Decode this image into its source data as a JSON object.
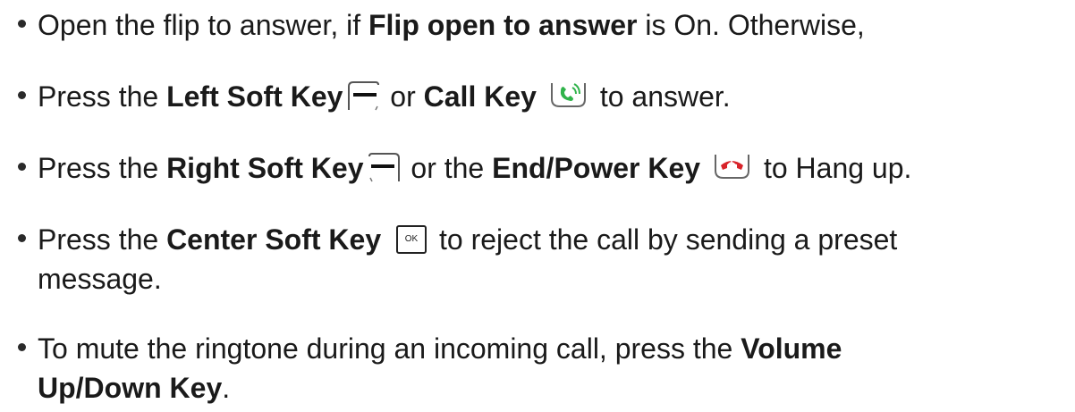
{
  "items": [
    {
      "t1": "Open the flip to answer, if ",
      "b1": "Flip open to answer",
      "t2": " is On.  Otherwise,"
    },
    {
      "t1": "Press the ",
      "b1": "Left Soft Key",
      "t2": " or ",
      "b2": "Call Key",
      "t3": " to answer.",
      "icon1": "left-soft-key-icon",
      "icon2": "call-key-icon"
    },
    {
      "t1": "Press the ",
      "b1": "Right Soft Key",
      "t2": " or the ",
      "b2": "End/Power Key",
      "t3": " to Hang up.",
      "icon1": "right-soft-key-icon",
      "icon2": "end-power-key-icon"
    },
    {
      "t1": "Press the ",
      "b1": "Center Soft Key",
      "t2": " to reject the call by sending a preset",
      "t3": "message.",
      "icon1": "center-soft-key-icon",
      "icon_label": "OK"
    },
    {
      "t1": "To mute the ringtone during an incoming call, press the ",
      "b1": "Volume",
      "b2": "Up/Down Key",
      "t2": "."
    }
  ],
  "colors": {
    "call_green": "#2fb34a",
    "end_red": "#d8232a",
    "text": "#1a1a1a"
  }
}
